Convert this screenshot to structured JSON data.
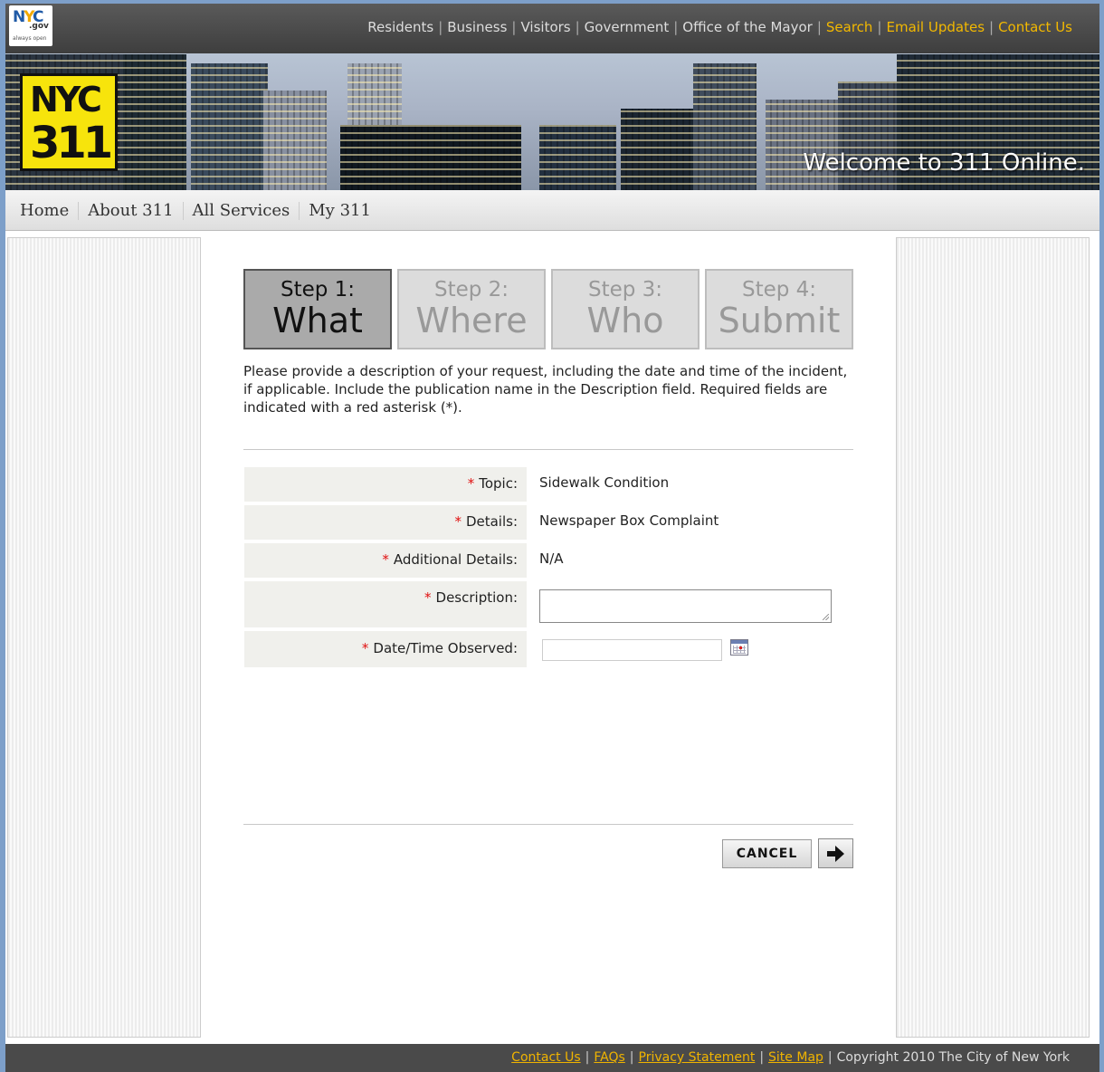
{
  "topnav": {
    "items": [
      {
        "label": "Residents"
      },
      {
        "label": "Business"
      },
      {
        "label": "Visitors"
      },
      {
        "label": "Government"
      },
      {
        "label": "Office of the Mayor"
      },
      {
        "label": "Search"
      },
      {
        "label": "Email Updates"
      },
      {
        "label": "Contact Us"
      }
    ],
    "link_color": "#dddddd",
    "highlight_color": "#f2b800"
  },
  "logos": {
    "nycgov": {
      "nyc": "NYC",
      "gov": ".gov",
      "tagline": "always open"
    },
    "nyc311": {
      "line1": "NYC",
      "line2": "311"
    }
  },
  "banner": {
    "welcome": "Welcome to 311 Online."
  },
  "mainnav": {
    "items": [
      {
        "label": "Home"
      },
      {
        "label": "About 311"
      },
      {
        "label": "All Services"
      },
      {
        "label": "My 311"
      }
    ]
  },
  "steps": [
    {
      "label": "Step 1:",
      "title": "What",
      "state": "active"
    },
    {
      "label": "Step 2:",
      "title": "Where",
      "state": "inactive"
    },
    {
      "label": "Step 3:",
      "title": "Who",
      "state": "inactive"
    },
    {
      "label": "Step 4:",
      "title": "Submit",
      "state": "inactive"
    }
  ],
  "intro": "Please provide a description of your request, including the date and time of the incident, if applicable. Include the publication name in the Description field. Required fields are indicated with a red asterisk (*).",
  "form": {
    "asterisk": "*",
    "topic": {
      "label": "Topic:",
      "value": "Sidewalk Condition"
    },
    "details": {
      "label": "Details:",
      "value": "Newspaper Box Complaint"
    },
    "additional": {
      "label": "Additional Details:",
      "value": "N/A"
    },
    "description": {
      "label": "Description:",
      "value": ""
    },
    "datetime": {
      "label": "Date/Time Observed:",
      "value": ""
    }
  },
  "buttons": {
    "cancel": "CANCEL"
  },
  "footer": {
    "links": [
      {
        "label": "Contact Us"
      },
      {
        "label": "FAQs"
      },
      {
        "label": "Privacy Statement"
      },
      {
        "label": "Site Map"
      }
    ],
    "copyright": "Copyright 2010 The City of New York"
  },
  "colors": {
    "required_asterisk": "#e01010",
    "footer_link": "#f0b400",
    "logo_yellow": "#f7e40c"
  }
}
